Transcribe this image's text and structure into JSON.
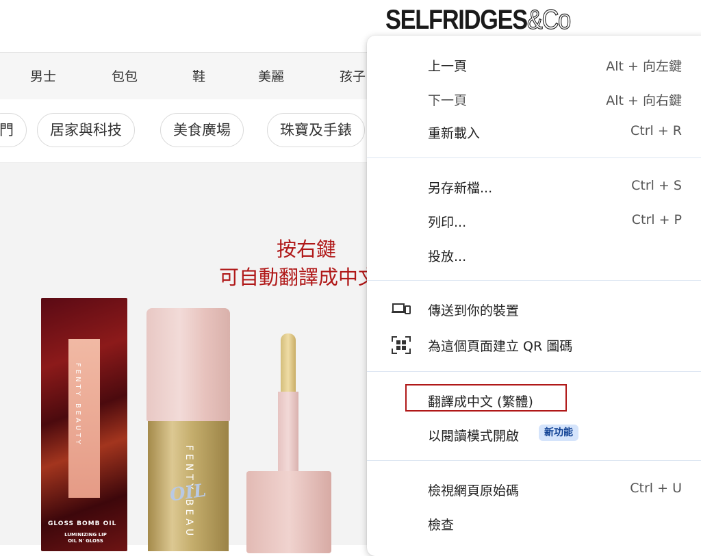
{
  "site": {
    "logo_text": "SELFRIDGES",
    "logo_amp": "&Co"
  },
  "nav": {
    "items": [
      "男士",
      "包包",
      "鞋",
      "美麗",
      "孩子"
    ]
  },
  "categories": {
    "pills": [
      "門",
      "居家與科技",
      "美食廣場",
      "珠寶及手錶"
    ]
  },
  "annotation": {
    "line1": "按右鍵",
    "line2": "可自動翻譯成中文"
  },
  "product": {
    "box_brand": "FENTY BEAUTY",
    "box_title": "GLOSS BOMB OIL",
    "box_subtitle": "LUMINIZING LIP OIL N' GLOSS",
    "bottle_brand": "FENTY BEAU",
    "bottle_oil": "OIL"
  },
  "context_menu": {
    "back": {
      "label": "上一頁",
      "shortcut": "Alt + 向左鍵"
    },
    "forward": {
      "label": "下一頁",
      "shortcut": "Alt + 向右鍵"
    },
    "reload": {
      "label": "重新載入",
      "shortcut": "Ctrl + R"
    },
    "save_as": {
      "label": "另存新檔...",
      "shortcut": "Ctrl + S"
    },
    "print": {
      "label": "列印...",
      "shortcut": "Ctrl + P"
    },
    "cast": {
      "label": "投放..."
    },
    "send_to_devices": {
      "label": "傳送到你的裝置",
      "icon": "devices-icon"
    },
    "qr_code": {
      "label": "為這個頁面建立 QR 圖碼",
      "icon": "qr-code-icon"
    },
    "translate": {
      "label": "翻譯成中文 (繁體)"
    },
    "reading_mode": {
      "label": "以閱讀模式開啟",
      "badge": "新功能"
    },
    "view_source": {
      "label": "檢視網頁原始碼",
      "shortcut": "Ctrl + U"
    },
    "inspect": {
      "label": "檢查"
    }
  },
  "colors": {
    "annotation": "#b01818",
    "badge_bg": "#d5e4fb",
    "badge_text": "#0b3d91"
  }
}
